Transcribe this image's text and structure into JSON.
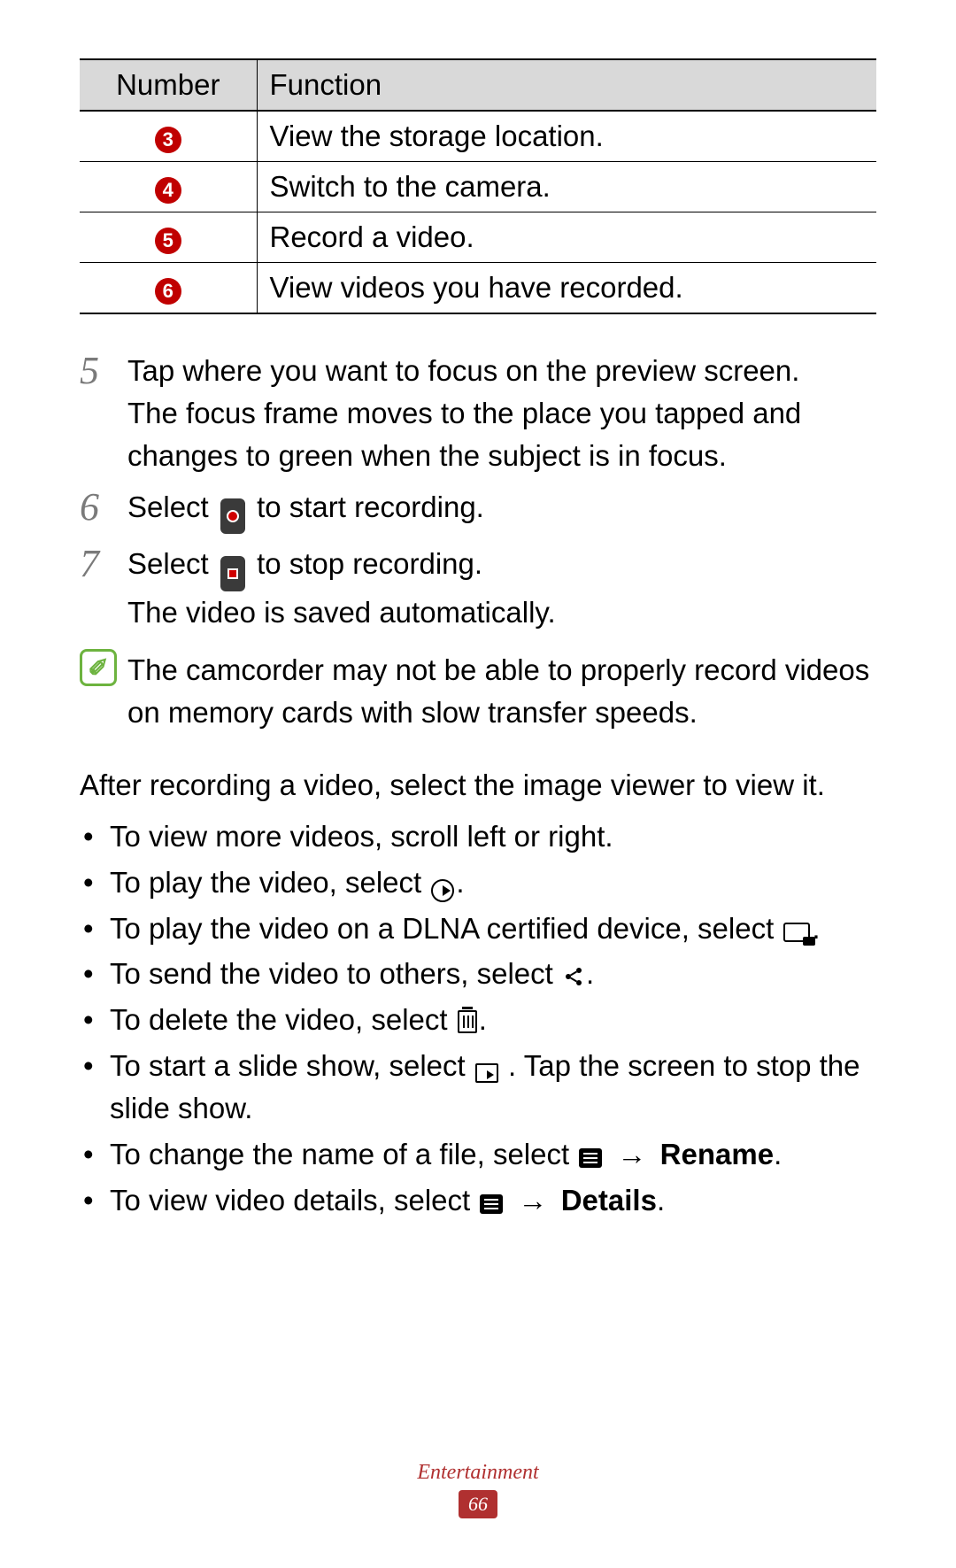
{
  "table": {
    "headers": {
      "number": "Number",
      "function": "Function"
    },
    "rows": [
      {
        "num": "3",
        "func": "View the storage location."
      },
      {
        "num": "4",
        "func": "Switch to the camera."
      },
      {
        "num": "5",
        "func": "Record a video."
      },
      {
        "num": "6",
        "func": "View videos you have recorded."
      }
    ]
  },
  "steps": {
    "s5": {
      "num": "5",
      "l1": "Tap where you want to focus on the preview screen.",
      "l2": "The focus frame moves to the place you tapped and changes to green when the subject is in focus."
    },
    "s6": {
      "num": "6",
      "pre": "Select ",
      "post": " to start recording."
    },
    "s7": {
      "num": "7",
      "pre": "Select ",
      "post": " to stop recording.",
      "l2": "The video is saved automatically."
    }
  },
  "note": {
    "glyph": "✐",
    "text": "The camcorder may not be able to properly record videos on memory cards with slow transfer speeds."
  },
  "after_para": "After recording a video, select the image viewer to view it.",
  "bullets": {
    "b1": "To view more videos, scroll left or right.",
    "b2_pre": "To play the video, select ",
    "b3_pre": "To play the video on a DLNA certified device, select ",
    "b4_pre": "To send the video to others, select ",
    "b5_pre": "To delete the video, select ",
    "b6_pre": "To start a slide show, select ",
    "b6_post": ". Tap the screen to stop the slide show.",
    "b7_pre": "To change the name of a file, select ",
    "b7_action": "Rename",
    "b8_pre": "To view video details, select ",
    "b8_action": "Details",
    "arrow": "→",
    "period": "."
  },
  "footer": {
    "section": "Entertainment",
    "page": "66"
  }
}
